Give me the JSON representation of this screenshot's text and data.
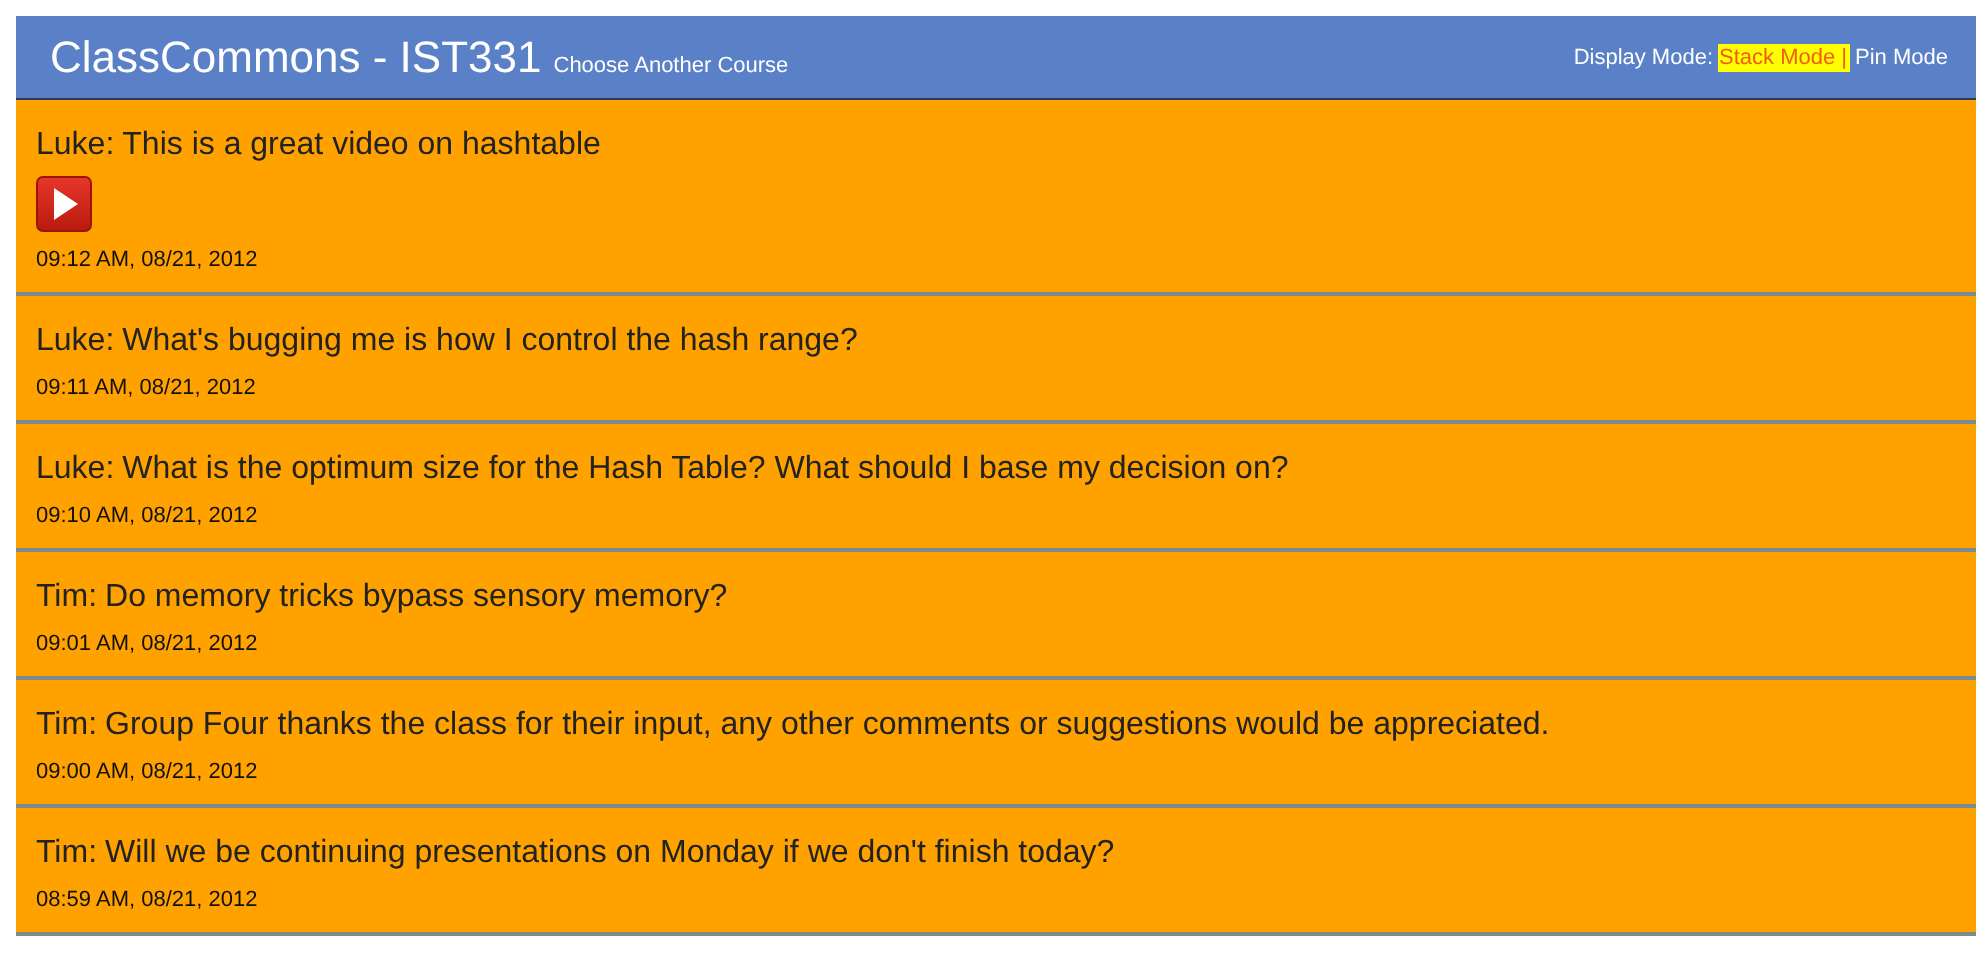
{
  "header": {
    "title": "ClassCommons - IST331",
    "course_link": "Choose Another Course",
    "display_mode_label": "Display Mode:",
    "modes": [
      {
        "label": "Stack Mode |",
        "selected": true
      },
      {
        "label": "Pin Mode",
        "selected": false
      }
    ]
  },
  "posts": [
    {
      "kind": "video",
      "author": "Luke:",
      "text": "This is a great video on hashtable",
      "time": "09:12 AM, 08/21, 2012"
    },
    {
      "kind": "text",
      "author": "Luke:",
      "text": "What's bugging me is how I control the hash range?",
      "time": "09:11 AM, 08/21, 2012"
    },
    {
      "kind": "text",
      "author": "Luke:",
      "text": "What is the optimum size for the Hash Table? What should I base my decision on?",
      "time": "09:10 AM, 08/21, 2012"
    },
    {
      "kind": "text",
      "author": "Tim:",
      "text": "Do memory tricks bypass sensory memory?",
      "time": "09:01 AM, 08/21, 2012"
    },
    {
      "kind": "text",
      "author": "Tim:",
      "text": "Group Four thanks the class for their input, any other comments or suggestions would be appreciated.",
      "time": "09:00 AM, 08/21, 2012"
    },
    {
      "kind": "text",
      "author": "Tim:",
      "text": "Will we be continuing presentations on Monday if we don't finish today?",
      "time": "08:59 AM, 08/21, 2012"
    }
  ]
}
